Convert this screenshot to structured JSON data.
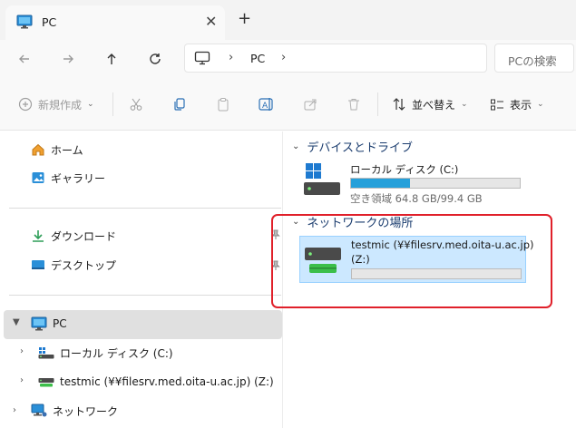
{
  "tab": {
    "title": "PC",
    "close_icon": "close-icon",
    "new_tab_icon": "plus-icon"
  },
  "navigation": {
    "back": "arrow-left-icon",
    "forward": "arrow-right-icon",
    "up": "arrow-up-icon",
    "refresh": "refresh-icon"
  },
  "address_bar": {
    "crumbs": [
      "PC"
    ],
    "separator": "›"
  },
  "search": {
    "placeholder": "PCの検索"
  },
  "command_bar": {
    "new_label": "新規作成",
    "sort_label": "並べ替え",
    "view_label": "表示"
  },
  "nav_pane": {
    "home": "ホーム",
    "gallery": "ギャラリー",
    "downloads": "ダウンロード",
    "desktop": "デスクトップ",
    "pc": "PC",
    "local_disk": "ローカル ディスク (C:)",
    "network_drive": "testmic (¥¥filesrv.med.oita-u.ac.jp) (Z:)",
    "network": "ネットワーク"
  },
  "content": {
    "devices_header": "デバイスとドライブ",
    "local_disk": {
      "name": "ローカル ディスク (C:)",
      "free_text": "空き領域 64.8 GB/99.4 GB",
      "used_fraction": 0.35
    },
    "network_header": "ネットワークの場所",
    "network_drive": {
      "name_line1": "testmic (¥¥filesrv.med.oita-u.ac.jp)",
      "name_line2": "(Z:)",
      "used_fraction": 0.0
    }
  },
  "colors": {
    "accent": "#26a0da",
    "selection": "#cce8ff",
    "highlight_box": "#e0202a"
  }
}
